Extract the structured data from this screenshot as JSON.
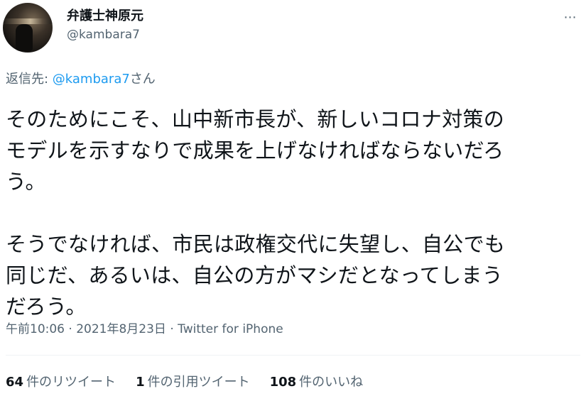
{
  "author": {
    "display_name": "弁護士神原元",
    "handle": "@kambara7"
  },
  "more_icon": "⋯",
  "reply": {
    "prefix": "返信先: ",
    "handle": "@kambara7",
    "suffix": "さん"
  },
  "tweet": {
    "text": "そのためにこそ、山中新市長が、新しいコロナ対策の\nモデルを示すなりで成果を上げなければならないだろ\nう。\n\nそうでなければ、市民は政権交代に失望し、自公でも\n同じだ、あるいは、自公の方がマシだとなってしまう\nだろう。"
  },
  "meta": {
    "time": "午前10:06",
    "separator1": " · ",
    "date": "2021年8月23日",
    "separator2": " · ",
    "source": "Twitter for iPhone"
  },
  "stats": {
    "retweets": {
      "count": "64",
      "label": "件のリツイート"
    },
    "quotes": {
      "count": "1",
      "label": "件の引用ツイート"
    },
    "likes": {
      "count": "108",
      "label": "件のいいね"
    }
  },
  "colors": {
    "text": "#0f1419",
    "secondary": "#536471",
    "link": "#1d9bf0",
    "divider": "#eff3f4"
  }
}
